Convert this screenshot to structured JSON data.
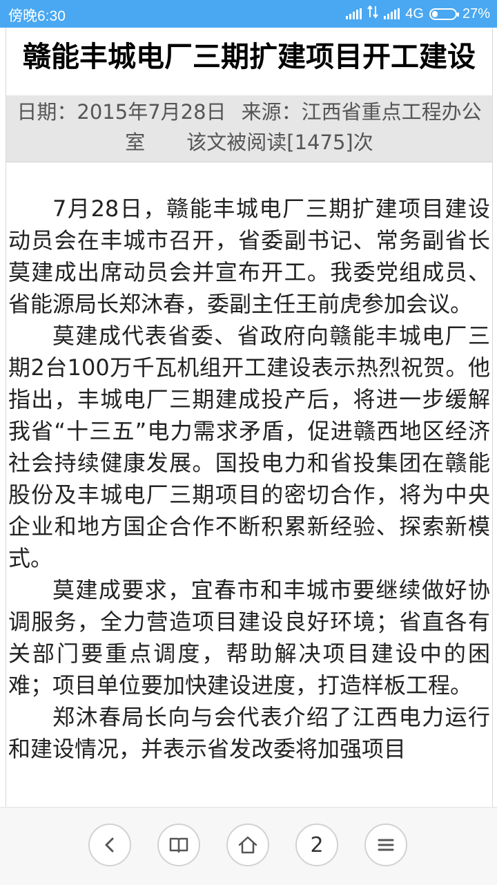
{
  "status_bar": {
    "time": "傍晚6:30",
    "network": "4G",
    "battery": "27%",
    "icons": [
      "signal-icon",
      "data-transfer-icon",
      "signal-icon",
      "battery-icon"
    ]
  },
  "article": {
    "title": "赣能丰城电厂三期扩建项目开工建设",
    "date_label": "日期：",
    "date": "2015年7月28日",
    "source_label": "来源：",
    "source": "江西省重点工程办公室",
    "read_prefix": "该文被阅读",
    "read_count": "[1475]",
    "read_suffix": "次",
    "paragraphs": [
      "7月28日，赣能丰城电厂三期扩建项目建设动员会在丰城市召开，省委副书记、常务副省长莫建成出席动员会并宣布开工。我委党组成员、省能源局长郑沐春，委副主任王前虎参加会议。",
      "莫建成代表省委、省政府向赣能丰城电厂三期2台100万千瓦机组开工建设表示热烈祝贺。他指出，丰城电厂三期建成投产后，将进一步缓解我省“十三五”电力需求矛盾，促进赣西地区经济社会持续健康发展。国投电力和省投集团在赣能股份及丰城电厂三期项目的密切合作，将为中央企业和地方国企合作不断积累新经验、探索新模式。",
      "莫建成要求，宜春市和丰城市要继续做好协调服务，全力营造项目建设良好环境；省直各有关部门要重点调度，帮助解决项目建设中的困难；项目单位要加快建设进度，打造样板工程。",
      "郑沐春局长向与会代表介绍了江西电力运行和建设情况，并表示省发改委将加强项目"
    ]
  },
  "bottom_nav": {
    "tab_count": "2",
    "icons": [
      "back-icon",
      "bookmarks-icon",
      "home-icon",
      "tabs-icon",
      "menu-icon"
    ]
  }
}
